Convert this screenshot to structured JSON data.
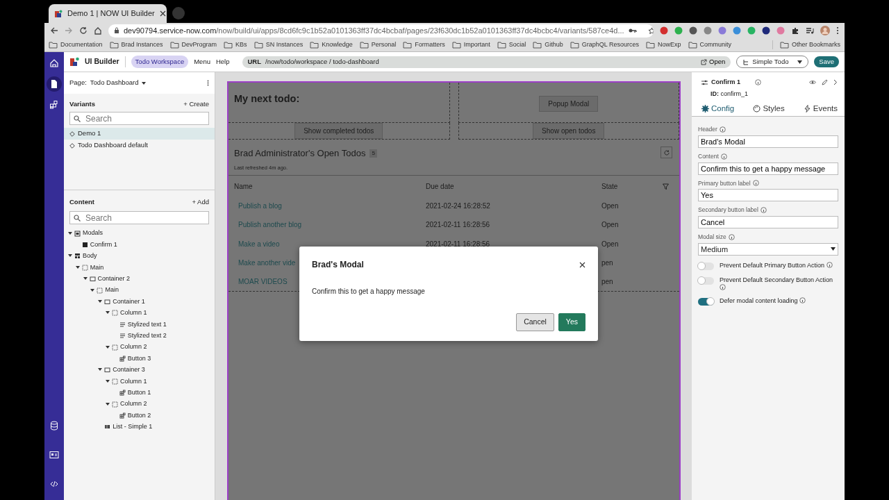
{
  "browser": {
    "tab_title": "Demo 1 | NOW UI Builder",
    "url_host": "dev90794.service-now.com",
    "url_path": "/now/build/ui/apps/8cd6fc9c1b52a0101363ff37dc4bcbaf/pages/23f630dc1b52a0101363ff37dc4bcbc4/variants/587ce4d...",
    "bookmarks": [
      "Documentation",
      "Brad Instances",
      "DevProgram",
      "KBs",
      "SN Instances",
      "Knowledge",
      "Personal",
      "Formatters",
      "Important",
      "Social",
      "Github",
      "GraphQL Resources",
      "NowExp",
      "Community"
    ],
    "other_bookmarks": "Other Bookmarks"
  },
  "rail": {
    "top": [
      {
        "selected": false
      },
      {
        "selected": true
      },
      {
        "selected": false
      }
    ]
  },
  "header": {
    "app_name": "UI Builder",
    "workspace": "Todo Workspace",
    "menu": [
      "Menu",
      "Help"
    ],
    "url_label": "URL",
    "url": "/now/todo/workspace / todo-dashboard",
    "open": "Open",
    "experience": "Simple Todo",
    "save": "Save"
  },
  "left_panel": {
    "page_label": "Page:",
    "page": "Todo Dashboard",
    "variants": {
      "title": "Variants",
      "action": "+ Create",
      "search_placeholder": "Search",
      "items": [
        {
          "label": "Demo 1",
          "selected": true
        },
        {
          "label": "Todo Dashboard default",
          "selected": false
        }
      ]
    },
    "content": {
      "title": "Content",
      "action": "+ Add",
      "search_placeholder": "Search",
      "tree": [
        {
          "label": "Modals",
          "kind": "modals",
          "expanded": true,
          "children": [
            {
              "label": "Confirm 1",
              "kind": "modal"
            }
          ]
        },
        {
          "label": "Body",
          "kind": "body",
          "expanded": true,
          "children": [
            {
              "label": "Main",
              "kind": "slot",
              "expanded": true,
              "children": [
                {
                  "label": "Container 2",
                  "kind": "container",
                  "expanded": true,
                  "children": [
                    {
                      "label": "Main",
                      "kind": "slot",
                      "expanded": true,
                      "children": [
                        {
                          "label": "Container 1",
                          "kind": "container",
                          "expanded": true,
                          "children": [
                            {
                              "label": "Column 1",
                              "kind": "slot",
                              "expanded": true,
                              "children": [
                                {
                                  "label": "Stylized text 1",
                                  "kind": "text"
                                },
                                {
                                  "label": "Stylized text 2",
                                  "kind": "text"
                                }
                              ]
                            },
                            {
                              "label": "Column 2",
                              "kind": "slot",
                              "expanded": true,
                              "children": [
                                {
                                  "label": "Button 3",
                                  "kind": "button"
                                }
                              ]
                            }
                          ]
                        },
                        {
                          "label": "Container 3",
                          "kind": "container",
                          "expanded": true,
                          "children": [
                            {
                              "label": "Column 1",
                              "kind": "slot",
                              "expanded": true,
                              "children": [
                                {
                                  "label": "Button 1",
                                  "kind": "button"
                                }
                              ]
                            },
                            {
                              "label": "Column 2",
                              "kind": "slot",
                              "expanded": true,
                              "children": [
                                {
                                  "label": "Button 2",
                                  "kind": "button"
                                }
                              ]
                            }
                          ]
                        },
                        {
                          "label": "List - Simple 1",
                          "kind": "list"
                        }
                      ]
                    }
                  ]
                }
              ]
            }
          ]
        }
      ]
    }
  },
  "canvas": {
    "heading": "My next todo:",
    "popup_button": "Popup Modal",
    "column_buttons": [
      "Show completed todos",
      "Show open todos"
    ],
    "list": {
      "title": "Brad Administrator's Open Todos",
      "count": "5",
      "refreshed": "Last refreshed 4m ago.",
      "columns": [
        "Name",
        "Due date",
        "State"
      ],
      "rows": [
        {
          "name": "Publish a blog",
          "due": "2021-02-24 16:28:52",
          "state": "Open"
        },
        {
          "name": "Publish another blog",
          "due": "2021-02-11 16:28:56",
          "state": "Open"
        },
        {
          "name": "Make a video",
          "due": "2021-02-11 16:28:56",
          "state": "Open"
        },
        {
          "name": "Make another vide",
          "state": "pen"
        },
        {
          "name": "MOAR VIDEOS",
          "state": "pen"
        }
      ]
    }
  },
  "modal": {
    "title": "Brad's Modal",
    "body": "Confirm this to get a happy message",
    "buttons": [
      {
        "label": "Cancel",
        "kind": "secondary"
      },
      {
        "label": "Yes",
        "kind": "primary"
      }
    ]
  },
  "inspector": {
    "title": "Confirm 1",
    "id_label": "ID:",
    "id": "confirm_1",
    "tabs": [
      {
        "label": "Config",
        "selected": true
      },
      {
        "label": "Styles",
        "selected": false
      },
      {
        "label": "Events",
        "selected": false
      }
    ],
    "fields": [
      {
        "label": "Header",
        "value": "Brad's Modal",
        "kind": "text"
      },
      {
        "label": "Content",
        "value": "Confirm this to get a happy message",
        "kind": "text"
      },
      {
        "label": "Primary button label",
        "value": "Yes",
        "kind": "text"
      },
      {
        "label": "Secondary button label",
        "value": "Cancel",
        "kind": "text"
      },
      {
        "label": "Modal size",
        "value": "Medium",
        "kind": "select"
      }
    ],
    "toggles": [
      {
        "label": "Prevent Default Primary Button Action",
        "on": false
      },
      {
        "label": "Prevent Default Secondary Button Action",
        "on": false
      },
      {
        "label": "Defer modal content loading",
        "on": true
      }
    ]
  }
}
